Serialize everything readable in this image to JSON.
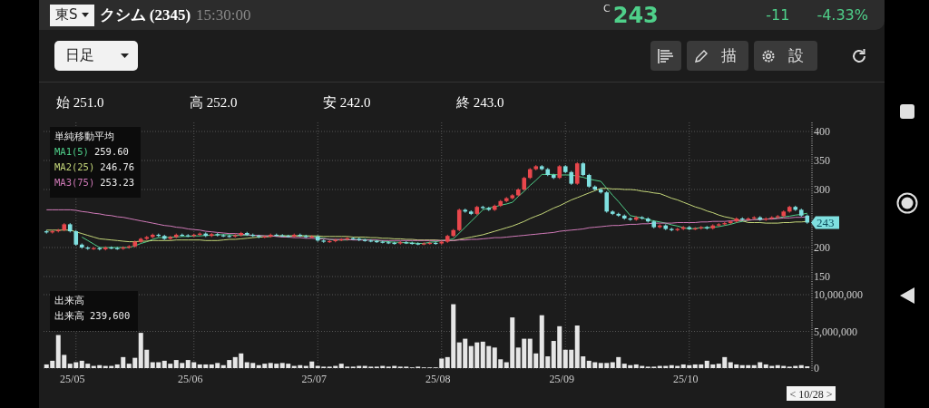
{
  "header": {
    "market": "東S",
    "name": "クシム (2345)",
    "time": "15:30:00",
    "price_prefix": "C",
    "price": "243",
    "change": "-11",
    "change_pct": "-4.33%"
  },
  "toolbar": {
    "period": "日足",
    "tools": [
      {
        "kind": "list"
      },
      {
        "kind": "draw",
        "label": "描"
      },
      {
        "kind": "settings",
        "label": "設"
      },
      {
        "kind": "refresh"
      }
    ]
  },
  "ohlc": [
    {
      "label": "始",
      "value": "251.0"
    },
    {
      "label": "高",
      "value": "252.0"
    },
    {
      "label": "安",
      "value": "242.0"
    },
    {
      "label": "終",
      "value": "243.0"
    }
  ],
  "price_chart": {
    "legend_title": "単純移動平均",
    "legend_values": [
      "259.60",
      "246.76",
      "253.23"
    ],
    "last_label": "243",
    "chart_data": {
      "type": "candlestick",
      "ylim": [
        150,
        400
      ],
      "yticks": [
        150,
        200,
        300,
        350,
        400
      ],
      "grid": true,
      "categories": [
        null,
        null,
        null,
        null,
        null,
        null,
        null,
        null,
        null,
        null,
        null,
        null,
        null,
        null,
        null,
        null,
        null,
        null,
        null,
        null,
        null,
        null,
        null,
        null,
        null,
        null,
        null,
        null,
        null,
        null,
        null,
        null,
        null,
        null,
        null,
        null,
        null,
        null,
        null,
        null,
        null,
        null,
        null,
        null,
        null,
        null,
        null,
        null,
        null,
        null,
        null,
        null,
        null,
        null,
        null,
        null,
        null,
        null,
        null,
        null,
        null,
        null,
        null,
        null,
        null,
        null,
        null,
        null,
        null,
        null,
        null,
        null,
        null,
        null,
        null,
        null,
        null,
        null,
        null,
        null,
        null,
        null,
        null,
        null,
        null,
        null,
        null,
        null,
        null,
        null,
        null,
        null,
        null,
        null,
        null,
        null,
        null,
        null,
        null,
        null,
        null,
        null,
        null,
        null,
        null,
        null,
        null,
        null,
        null,
        null,
        null,
        null,
        null,
        null,
        null,
        null,
        null,
        null,
        null,
        null,
        null,
        null,
        null,
        null,
        null,
        null,
        null,
        null,
        null,
        null
      ],
      "ohlc": [
        [
          228,
          230,
          224,
          226
        ],
        [
          226,
          230,
          224,
          228
        ],
        [
          228,
          232,
          226,
          230
        ],
        [
          230,
          242,
          228,
          240
        ],
        [
          240,
          242,
          226,
          228
        ],
        [
          228,
          230,
          203,
          205
        ],
        [
          205,
          207,
          198,
          200
        ],
        [
          200,
          202,
          196,
          198
        ],
        [
          198,
          201,
          196,
          199
        ],
        [
          199,
          201,
          195,
          197
        ],
        [
          197,
          202,
          195,
          200
        ],
        [
          200,
          202,
          197,
          199
        ],
        [
          199,
          201,
          196,
          198
        ],
        [
          198,
          202,
          196,
          200
        ],
        [
          200,
          204,
          198,
          202
        ],
        [
          202,
          212,
          200,
          210
        ],
        [
          210,
          217,
          208,
          215
        ],
        [
          215,
          220,
          213,
          218
        ],
        [
          218,
          224,
          216,
          222
        ],
        [
          222,
          224,
          218,
          220
        ],
        [
          220,
          222,
          213,
          215
        ],
        [
          215,
          220,
          213,
          218
        ],
        [
          218,
          224,
          216,
          222
        ],
        [
          222,
          224,
          219,
          221
        ],
        [
          221,
          223,
          218,
          220
        ],
        [
          220,
          224,
          218,
          222
        ],
        [
          222,
          226,
          220,
          224
        ],
        [
          224,
          226,
          218,
          220
        ],
        [
          220,
          225,
          218,
          223
        ],
        [
          223,
          225,
          219,
          221
        ],
        [
          221,
          223,
          218,
          220
        ],
        [
          220,
          222,
          217,
          219
        ],
        [
          219,
          223,
          217,
          221
        ],
        [
          221,
          227,
          219,
          225
        ],
        [
          225,
          227,
          220,
          222
        ],
        [
          222,
          224,
          218,
          220
        ],
        [
          220,
          222,
          216,
          218
        ],
        [
          218,
          221,
          216,
          219
        ],
        [
          219,
          224,
          217,
          222
        ],
        [
          222,
          224,
          219,
          221
        ],
        [
          221,
          223,
          218,
          220
        ],
        [
          220,
          222,
          217,
          219
        ],
        [
          219,
          224,
          217,
          222
        ],
        [
          222,
          224,
          218,
          220
        ],
        [
          220,
          222,
          216,
          218
        ],
        [
          218,
          221,
          216,
          219
        ],
        [
          219,
          221,
          210,
          212
        ],
        [
          212,
          214,
          208,
          210
        ],
        [
          210,
          213,
          208,
          211
        ],
        [
          211,
          215,
          209,
          213
        ],
        [
          213,
          216,
          211,
          214
        ],
        [
          214,
          218,
          212,
          216
        ],
        [
          216,
          218,
          213,
          215
        ],
        [
          215,
          217,
          211,
          213
        ],
        [
          213,
          215,
          210,
          212
        ],
        [
          212,
          214,
          209,
          211
        ],
        [
          211,
          213,
          208,
          210
        ],
        [
          210,
          212,
          207,
          209
        ],
        [
          209,
          211,
          206,
          208
        ],
        [
          208,
          210,
          205,
          207
        ],
        [
          207,
          211,
          205,
          209
        ],
        [
          209,
          211,
          206,
          208
        ],
        [
          208,
          210,
          205,
          207
        ],
        [
          207,
          209,
          204,
          206
        ],
        [
          206,
          209,
          204,
          207
        ],
        [
          207,
          210,
          205,
          208
        ],
        [
          208,
          210,
          205,
          207
        ],
        [
          207,
          212,
          205,
          210
        ],
        [
          210,
          222,
          208,
          220
        ],
        [
          220,
          232,
          218,
          230
        ],
        [
          230,
          267,
          228,
          265
        ],
        [
          265,
          267,
          260,
          262
        ],
        [
          262,
          264,
          256,
          258
        ],
        [
          258,
          272,
          256,
          270
        ],
        [
          270,
          272,
          266,
          268
        ],
        [
          268,
          270,
          263,
          265
        ],
        [
          265,
          274,
          263,
          272
        ],
        [
          272,
          282,
          270,
          280
        ],
        [
          280,
          287,
          278,
          285
        ],
        [
          285,
          292,
          283,
          290
        ],
        [
          290,
          302,
          288,
          300
        ],
        [
          300,
          322,
          298,
          320
        ],
        [
          320,
          337,
          318,
          335
        ],
        [
          335,
          342,
          333,
          340
        ],
        [
          340,
          342,
          333,
          335
        ],
        [
          335,
          337,
          323,
          325
        ],
        [
          325,
          327,
          318,
          320
        ],
        [
          320,
          342,
          318,
          340
        ],
        [
          340,
          342,
          328,
          330
        ],
        [
          330,
          332,
          308,
          310
        ],
        [
          310,
          347,
          308,
          345
        ],
        [
          345,
          347,
          323,
          325
        ],
        [
          325,
          327,
          303,
          305
        ],
        [
          305,
          307,
          298,
          300
        ],
        [
          300,
          302,
          293,
          295
        ],
        [
          295,
          297,
          260,
          262
        ],
        [
          262,
          264,
          256,
          258
        ],
        [
          258,
          260,
          253,
          255
        ],
        [
          255,
          257,
          248,
          250
        ],
        [
          250,
          252,
          246,
          248
        ],
        [
          248,
          254,
          246,
          252
        ],
        [
          252,
          254,
          248,
          250
        ],
        [
          250,
          252,
          243,
          245
        ],
        [
          245,
          247,
          233,
          235
        ],
        [
          235,
          240,
          233,
          238
        ],
        [
          238,
          240,
          230,
          232
        ],
        [
          232,
          234,
          228,
          230
        ],
        [
          230,
          234,
          228,
          232
        ],
        [
          232,
          237,
          230,
          235
        ],
        [
          235,
          237,
          230,
          232
        ],
        [
          232,
          235,
          230,
          233
        ],
        [
          233,
          237,
          231,
          235
        ],
        [
          235,
          237,
          231,
          233
        ],
        [
          233,
          240,
          231,
          238
        ],
        [
          238,
          242,
          236,
          240
        ],
        [
          240,
          244,
          238,
          242
        ],
        [
          242,
          247,
          240,
          245
        ],
        [
          245,
          252,
          243,
          250
        ],
        [
          250,
          252,
          246,
          248
        ],
        [
          248,
          252,
          246,
          250
        ],
        [
          250,
          254,
          248,
          252
        ],
        [
          252,
          254,
          246,
          248
        ],
        [
          248,
          252,
          246,
          250
        ],
        [
          250,
          254,
          248,
          252
        ],
        [
          252,
          256,
          250,
          254
        ],
        [
          254,
          264,
          252,
          262
        ],
        [
          262,
          272,
          260,
          270
        ],
        [
          270,
          272,
          263,
          265
        ],
        [
          265,
          267,
          253,
          255
        ],
        [
          255,
          257,
          241,
          243
        ]
      ],
      "series": [
        {
          "name": "MA1(5)",
          "type": "line",
          "color": "#4fd08a",
          "values": [
            null,
            null,
            null,
            null,
            null,
            null,
            218,
            212,
            206,
            200,
            200,
            200,
            200,
            200,
            200,
            203,
            207,
            210,
            214,
            217,
            217,
            218,
            218,
            219,
            219,
            220,
            220,
            221,
            221,
            222,
            222,
            222,
            221,
            221,
            221,
            221,
            221,
            220,
            220,
            220,
            220,
            220,
            220,
            220,
            220,
            219,
            217,
            216,
            214,
            213,
            213,
            213,
            214,
            214,
            214,
            213,
            212,
            211,
            210,
            209,
            209,
            208,
            208,
            207,
            207,
            209,
            210,
            212,
            213,
            215,
            225,
            235,
            245,
            255,
            265,
            268,
            270,
            273,
            275,
            278,
            288,
            297,
            307,
            316,
            326,
            326,
            326,
            325,
            325,
            325,
            323,
            321,
            318,
            316,
            314,
            302,
            290,
            279,
            267,
            255,
            253,
            251,
            248,
            246,
            244,
            242,
            239,
            237,
            234,
            232,
            233,
            234,
            234,
            235,
            236,
            238,
            240,
            243,
            245,
            247,
            248,
            249,
            249,
            250,
            251,
            253,
            254,
            256,
            257,
            259
          ]
        },
        {
          "name": "MA2(25)",
          "type": "line",
          "color": "#c5d77a",
          "values": [
            230,
            230,
            230,
            230,
            230,
            227,
            224,
            221,
            218,
            215,
            214,
            213,
            212,
            211,
            210,
            210,
            211,
            211,
            212,
            212,
            212,
            212,
            213,
            213,
            213,
            213,
            213,
            212,
            212,
            212,
            213,
            214,
            214,
            215,
            216,
            217,
            218,
            218,
            219,
            220,
            220,
            220,
            220,
            220,
            220,
            220,
            220,
            219,
            219,
            219,
            219,
            219,
            218,
            218,
            218,
            217,
            217,
            216,
            216,
            215,
            215,
            214,
            214,
            213,
            213,
            213,
            213,
            212,
            212,
            212,
            214,
            216,
            218,
            220,
            222,
            225,
            228,
            231,
            234,
            237,
            241,
            245,
            250,
            254,
            258,
            263,
            268,
            272,
            277,
            282,
            286,
            290,
            294,
            298,
            302,
            302,
            301,
            301,
            300,
            300,
            299,
            297,
            296,
            294,
            293,
            289,
            285,
            282,
            278,
            274,
            270,
            267,
            263,
            260,
            256,
            253,
            251,
            248,
            246,
            243,
            243,
            243,
            242,
            242,
            242,
            243,
            243,
            244,
            244,
            245
          ]
        },
        {
          "name": "MA3(75)",
          "type": "line",
          "color": "#d07ab8",
          "values": [
            265,
            265,
            265,
            265,
            265,
            264,
            262,
            261,
            259,
            258,
            256,
            255,
            253,
            252,
            250,
            248,
            246,
            244,
            242,
            240,
            238,
            237,
            235,
            234,
            232,
            231,
            230,
            228,
            227,
            226,
            225,
            224,
            224,
            223,
            222,
            221,
            221,
            220,
            220,
            219,
            218,
            218,
            217,
            217,
            216,
            216,
            215,
            215,
            214,
            214,
            214,
            214,
            213,
            213,
            213,
            213,
            213,
            212,
            212,
            212,
            212,
            212,
            212,
            212,
            212,
            212,
            212,
            212,
            212,
            212,
            213,
            213,
            214,
            214,
            215,
            216,
            217,
            217,
            218,
            219,
            220,
            221,
            222,
            223,
            224,
            225,
            226,
            228,
            229,
            230,
            231,
            232,
            234,
            235,
            236,
            237,
            238,
            238,
            239,
            240,
            240,
            241,
            241,
            242,
            242,
            242,
            242,
            243,
            243,
            243,
            243,
            244,
            244,
            245,
            245,
            245,
            246,
            246,
            247,
            247,
            248,
            248,
            249,
            249,
            250,
            251,
            251,
            252,
            252,
            253
          ]
        }
      ]
    }
  },
  "volume_chart": {
    "legend_title": "出来高",
    "legend_label": "出来高",
    "legend_value": "239,600",
    "date_badge": "< 10/28 >",
    "chart_data": {
      "type": "bar",
      "ylim": [
        0,
        10000000
      ],
      "grid": true,
      "yticks": [
        {
          "value": 0,
          "label": "0"
        },
        {
          "value": 5000000,
          "label": "5,000,000"
        },
        {
          "value": 10000000,
          "label": "10,000,000"
        }
      ],
      "categories": [
        null,
        null,
        null,
        null,
        null,
        "25/05",
        null,
        null,
        null,
        null,
        null,
        null,
        null,
        null,
        null,
        null,
        null,
        null,
        null,
        null,
        null,
        null,
        null,
        null,
        null,
        "25/06",
        null,
        null,
        null,
        null,
        null,
        null,
        null,
        null,
        null,
        null,
        null,
        null,
        null,
        null,
        null,
        null,
        null,
        null,
        null,
        null,
        "25/07",
        null,
        null,
        null,
        null,
        null,
        null,
        null,
        null,
        null,
        null,
        null,
        null,
        null,
        null,
        null,
        null,
        null,
        null,
        null,
        null,
        "25/08",
        null,
        null,
        null,
        null,
        null,
        null,
        null,
        null,
        null,
        null,
        null,
        null,
        null,
        null,
        null,
        null,
        null,
        null,
        null,
        null,
        "25/09",
        null,
        null,
        null,
        null,
        null,
        null,
        null,
        null,
        null,
        null,
        null,
        null,
        null,
        null,
        null,
        null,
        null,
        null,
        null,
        null,
        "25/10",
        null,
        null,
        null,
        null,
        null,
        null,
        null,
        null,
        null,
        null,
        null,
        null,
        null,
        null,
        null,
        null,
        null,
        null,
        null,
        null
      ],
      "values": [
        500000,
        1000000,
        4500000,
        1800000,
        600000,
        800000,
        1000000,
        600000,
        300000,
        400000,
        300000,
        300000,
        500000,
        1500000,
        600000,
        1400000,
        4800000,
        2500000,
        800000,
        800000,
        1000000,
        600000,
        1100000,
        700000,
        1100000,
        800000,
        500000,
        500000,
        500000,
        700000,
        400000,
        1100000,
        1500000,
        2000000,
        800000,
        700000,
        400000,
        600000,
        700000,
        600000,
        700000,
        600000,
        300000,
        400000,
        300000,
        900000,
        300000,
        200000,
        200000,
        300000,
        600000,
        200000,
        200000,
        300000,
        300000,
        200000,
        200000,
        300000,
        200000,
        300000,
        200000,
        200000,
        100000,
        200000,
        100000,
        100000,
        100000,
        1300000,
        1500000,
        8700000,
        3500000,
        4000000,
        3000000,
        3500000,
        3600000,
        3000000,
        2800000,
        1200000,
        800000,
        6900000,
        2800000,
        4000000,
        4000000,
        2000000,
        7200000,
        1600000,
        3700000,
        5700000,
        2500000,
        2500000,
        5800000,
        1600000,
        1000000,
        800000,
        700000,
        700000,
        800000,
        1500000,
        600000,
        400000,
        500000,
        300000,
        200000,
        200000,
        300000,
        300000,
        400000,
        300000,
        500000,
        400000,
        500000,
        500000,
        1000000,
        500000,
        600000,
        1500000,
        800000,
        500000,
        400000,
        400000,
        400000,
        800000,
        500000,
        300000,
        400000,
        300000,
        200000,
        300000,
        400000,
        240000
      ]
    }
  }
}
